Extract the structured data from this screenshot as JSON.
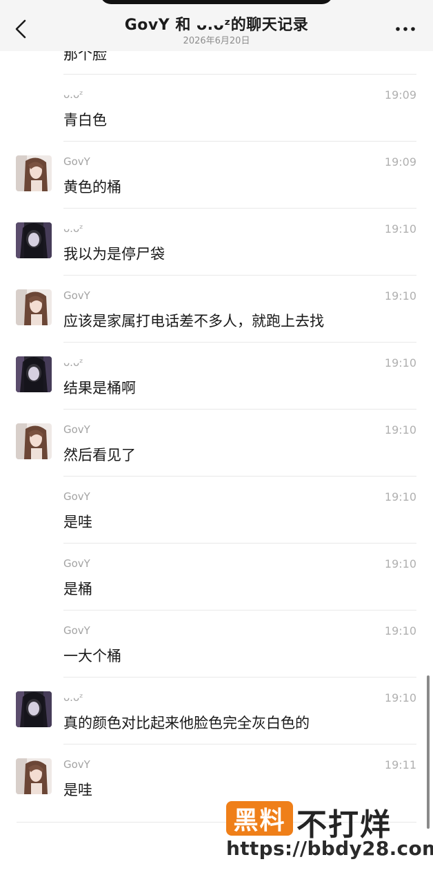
{
  "header": {
    "title": "GovY 和 ᴗ.ᴗᶻ的聊天记录",
    "subtitle": "2026年6月20日",
    "back_icon": "chevron-left-icon",
    "more_icon": "more-dots-icon"
  },
  "partial_message": {
    "text": "那个脸"
  },
  "messages": [
    {
      "sender": "ᴗ.ᴗᶻ",
      "time": "19:09",
      "text": "青白色",
      "avatar": "none"
    },
    {
      "sender": "GovY",
      "time": "19:09",
      "text": "黄色的桶",
      "avatar": "govy"
    },
    {
      "sender": "ᴗ.ᴗᶻ",
      "time": "19:10",
      "text": "我以为是停尸袋",
      "avatar": "other"
    },
    {
      "sender": "GovY",
      "time": "19:10",
      "text": "应该是家属打电话差不多人，就跑上去找",
      "avatar": "govy"
    },
    {
      "sender": "ᴗ.ᴗᶻ",
      "time": "19:10",
      "text": "结果是桶啊",
      "avatar": "other"
    },
    {
      "sender": "GovY",
      "time": "19:10",
      "text": "然后看见了",
      "avatar": "govy"
    },
    {
      "sender": "GovY",
      "time": "19:10",
      "text": "是哇",
      "avatar": "none"
    },
    {
      "sender": "GovY",
      "time": "19:10",
      "text": "是桶",
      "avatar": "none"
    },
    {
      "sender": "GovY",
      "time": "19:10",
      "text": "一大个桶",
      "avatar": "none"
    },
    {
      "sender": "ᴗ.ᴗᶻ",
      "time": "19:10",
      "text": "真的颜色对比起来他脸色完全灰白色的",
      "avatar": "other"
    },
    {
      "sender": "GovY",
      "time": "19:11",
      "text": "是哇",
      "avatar": "govy"
    }
  ],
  "watermark": {
    "logo_text": "黑料",
    "text": "不打烊",
    "url": "https://bbdy28.com",
    "color": "#ef7f19"
  }
}
